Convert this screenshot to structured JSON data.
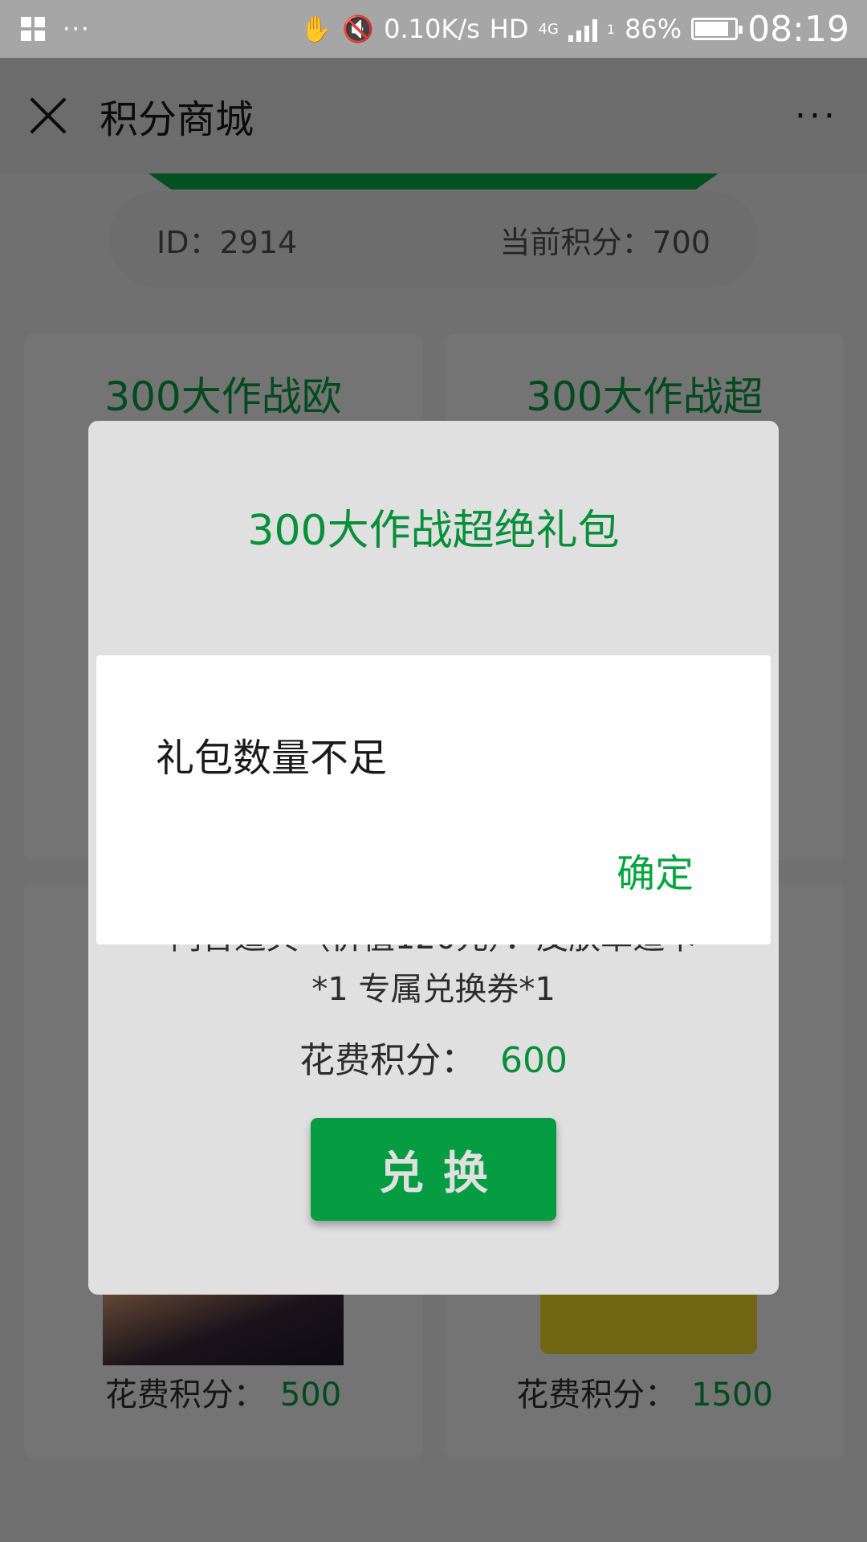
{
  "status_bar": {
    "network_speed": "0.10K/s",
    "hd": "HD",
    "net_type": "4G",
    "sim": "1",
    "battery": "86%",
    "time": "08:19",
    "overflow_dots": "···"
  },
  "header": {
    "title": "积分商城",
    "more": "···"
  },
  "account": {
    "id_text": "ID：2914",
    "points_text": "当前积分：700"
  },
  "cards": [
    {
      "title": "300大作战欧",
      "cost_label": "花费积分：",
      "cost_value": "500"
    },
    {
      "title": "300大作战超",
      "cost_label": "花费积分：",
      "cost_value": "1500"
    }
  ],
  "gift_modal": {
    "title": "300大作战超绝礼包",
    "desc_line1": "内含道具（价值120元）：皮肤革造卡",
    "desc_line2": "*1 专属兑换券*1",
    "cost_label": "花费积分：",
    "cost_value": "600",
    "exchange_label": "兑换"
  },
  "alert": {
    "message": "礼包数量不足",
    "ok_label": "确定"
  },
  "colors": {
    "accent_green": "#07a541",
    "button_green": "#07b24a",
    "banner_green": "#07b24a"
  }
}
